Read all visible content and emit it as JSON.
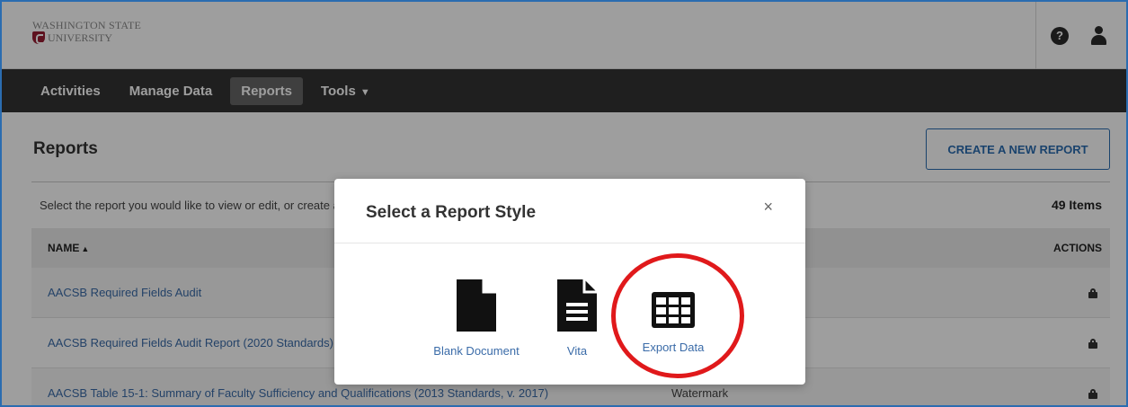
{
  "header": {
    "logo_line1": "WASHINGTON STATE",
    "logo_line2": "UNIVERSITY",
    "help_icon": "help-circle-icon",
    "user_icon": "user-icon"
  },
  "nav": {
    "items": [
      {
        "label": "Activities"
      },
      {
        "label": "Manage Data"
      },
      {
        "label": "Reports",
        "active": true
      },
      {
        "label": "Tools",
        "caret": "▼"
      }
    ]
  },
  "page": {
    "title": "Reports",
    "create_button": "CREATE A NEW REPORT",
    "instructions": "Select the report you would like to view or edit, or create a new report.",
    "items_count": "49 Items"
  },
  "table": {
    "col_name": "NAME",
    "col_name_sort": "▲",
    "col_actions": "ACTIONS",
    "rows": [
      {
        "name": "AACSB Required Fields Audit",
        "type": ""
      },
      {
        "name": "AACSB Required Fields Audit Report (2020 Standards)",
        "type": ""
      },
      {
        "name": "AACSB Table 15-1: Summary of Faculty Sufficiency and Qualifications (2013 Standards, v. 2017)",
        "type": "Watermark"
      }
    ]
  },
  "modal": {
    "title": "Select a Report Style",
    "close": "×",
    "options": [
      {
        "label": "Blank Document",
        "icon": "blank-document-icon"
      },
      {
        "label": "Vita",
        "icon": "vita-document-icon"
      },
      {
        "label": "Export Data",
        "icon": "table-grid-icon"
      }
    ]
  },
  "colors": {
    "nav_bg": "#333333",
    "link_blue": "#3a6ba8",
    "highlight_red": "#e0191b",
    "brand_crimson": "#981e32"
  }
}
